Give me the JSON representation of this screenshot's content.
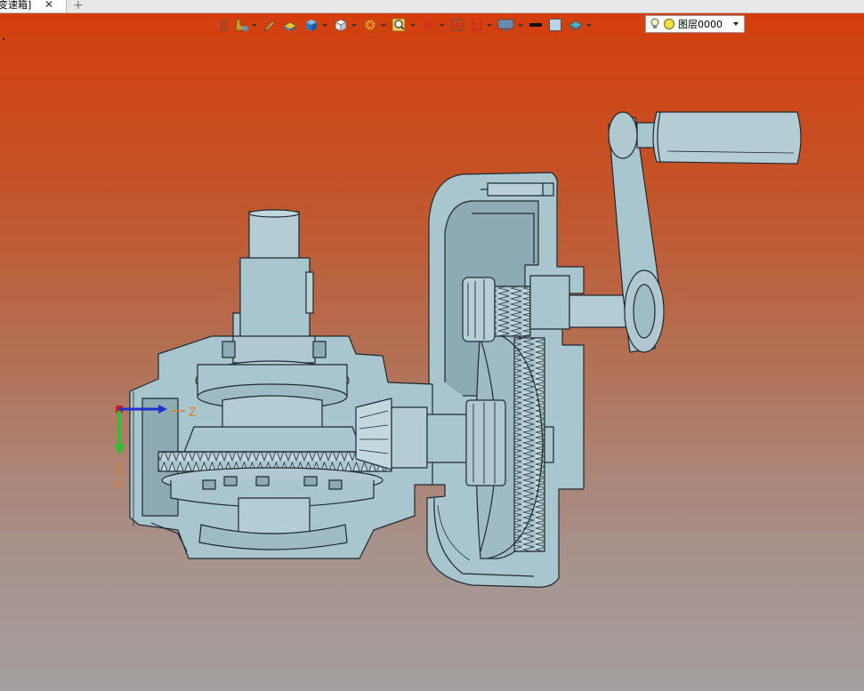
{
  "tabs": [
    {
      "label": "变速箱]",
      "active": true,
      "close_icon": "close-icon"
    }
  ],
  "new_tab_icon": "plus-icon",
  "toolbar": {
    "buttons": [
      {
        "name": "exit-icon",
        "has_dropdown": false
      },
      {
        "name": "pick-filter-icon",
        "has_dropdown": true
      },
      {
        "name": "pen-icon",
        "has_dropdown": false
      },
      {
        "name": "shading-icon",
        "has_dropdown": false
      },
      {
        "name": "solid-box-icon",
        "has_dropdown": true
      },
      {
        "name": "view-cube-icon",
        "has_dropdown": true
      },
      {
        "name": "render-mode-icon",
        "has_dropdown": true
      },
      {
        "name": "zoom-icon",
        "has_dropdown": true
      },
      {
        "name": "target-icon",
        "has_dropdown": true
      },
      {
        "name": "snap-icon",
        "has_dropdown": false
      },
      {
        "name": "section-icon",
        "has_dropdown": true
      },
      {
        "name": "display-icon",
        "has_dropdown": true
      },
      {
        "name": "line-color-icon",
        "has_dropdown": false
      },
      {
        "name": "face-color-icon",
        "has_dropdown": false
      },
      {
        "name": "layer-manager-icon",
        "has_dropdown": true
      }
    ],
    "layer": {
      "bulb_icon": "bulb-icon",
      "status_icon": "layer-status-icon",
      "value": "图层0000"
    }
  },
  "triad": {
    "z_label": "Z",
    "y_label": "Y"
  },
  "colors": {
    "background_top": "#d43e0c",
    "background_bottom": "#a39f9e",
    "model_fill": "#a9c5ce",
    "model_shade": "#8eaab4",
    "model_edge": "#1e2a30",
    "axis_label": "#e07a20"
  }
}
